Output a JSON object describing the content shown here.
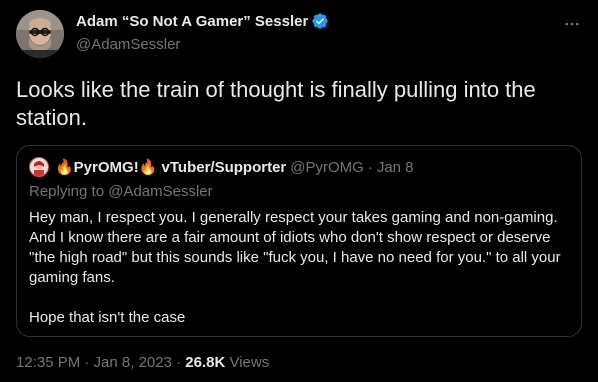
{
  "author": {
    "display_name": "Adam “So Not A Gamer” Sessler",
    "handle": "@AdamSessler",
    "verified": true,
    "verified_color": "#1d9bf0"
  },
  "tweet": {
    "text": "Looks like the train of thought is finally pulling into the station."
  },
  "quoted_tweet": {
    "display_name": "🔥PyrOMG!🔥 vTuber/Supporter",
    "handle": "@PyrOMG",
    "separator": "·",
    "date": "Jan 8",
    "replying_to": "Replying to @AdamSessler",
    "paragraphs": [
      "Hey man, I respect you. I generally respect your takes gaming and non-gaming. And I know there are a fair amount of idiots who don't show respect or deserve \"the high road\" but this sounds like \"fuck you, I have no need for you.\" to all your gaming fans.",
      "Hope that isn't the case"
    ]
  },
  "footer": {
    "timestamp": "12:35 PM · Jan 8, 2023 · ",
    "views_count": "26.8K",
    "views_label": " Views"
  },
  "colors": {
    "background": "#000000",
    "primary_text": "#e7e9ea",
    "secondary_text": "#71767b",
    "border": "#2f3336"
  },
  "icons": {
    "more": "more-horizontal-icon",
    "verified": "verified-badge-icon"
  }
}
